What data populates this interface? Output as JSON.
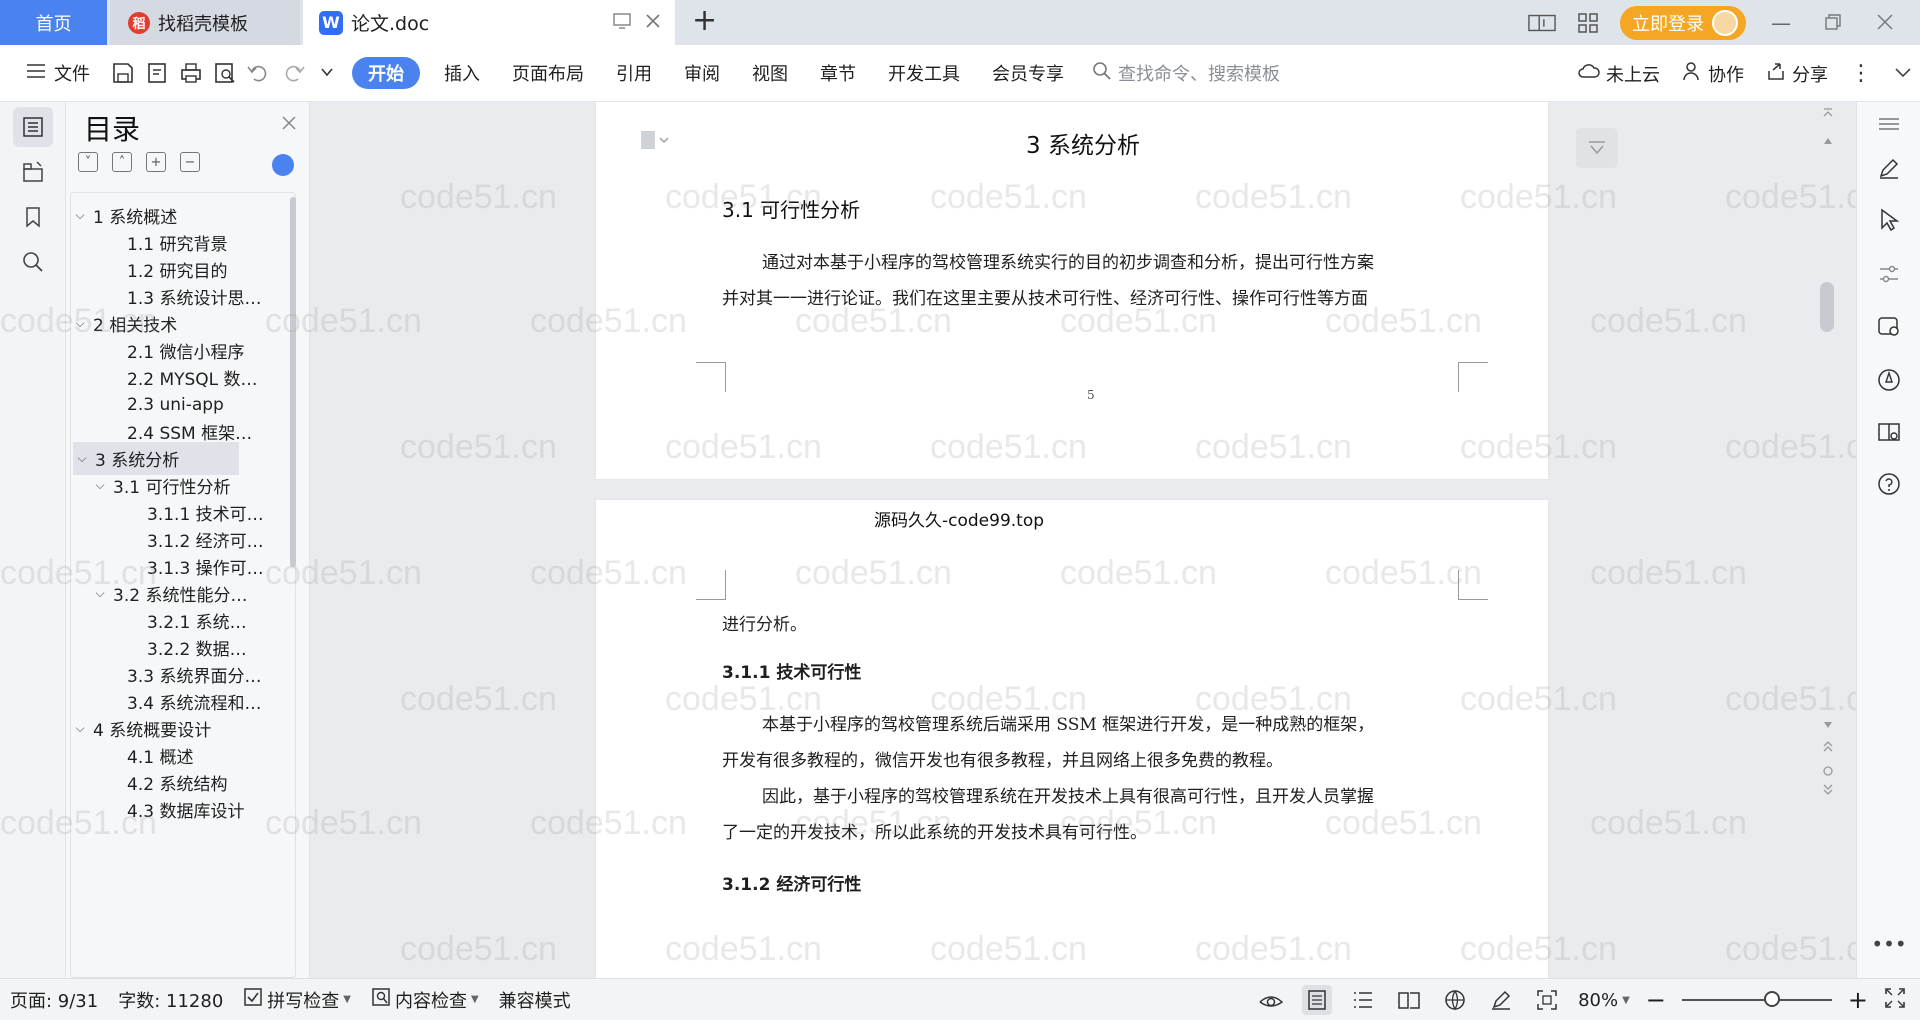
{
  "titlebar": {
    "home_tab": "首页",
    "template_tab": "找稻壳模板",
    "doc_tab": "论文.doc",
    "login_label": "立即登录"
  },
  "menubar": {
    "file": "文件",
    "items": [
      "开始",
      "插入",
      "页面布局",
      "引用",
      "审阅",
      "视图",
      "章节",
      "开发工具",
      "会员专享"
    ],
    "search_placeholder": "查找命令、搜索模板",
    "cloud": "未上云",
    "collab": "协作",
    "share": "分享"
  },
  "toc": {
    "title": "目录",
    "items": [
      {
        "label": "1 系统概述",
        "level": 1,
        "chevron": true
      },
      {
        "label": "1.1  研究背景",
        "level": 2,
        "chevron": false
      },
      {
        "label": "1.2 研究目的",
        "level": 2,
        "chevron": false
      },
      {
        "label": "1.3 系统设计思…",
        "level": 2,
        "chevron": false
      },
      {
        "label": "2 相关技术",
        "level": 1,
        "chevron": true
      },
      {
        "label": "2.1 微信小程序",
        "level": 2,
        "chevron": false
      },
      {
        "label": "2.2 MYSQL 数…",
        "level": 2,
        "chevron": false
      },
      {
        "label": "2.3 uni-app",
        "level": 2,
        "chevron": false
      },
      {
        "label": "2.4 SSM 框架…",
        "level": 2,
        "chevron": false
      },
      {
        "label": "3 系统分析",
        "level": 1,
        "chevron": true,
        "selected": true
      },
      {
        "label": "3.1 可行性分析",
        "level": 2,
        "chevron": true
      },
      {
        "label": "3.1.1 技术可…",
        "level": 3,
        "chevron": false
      },
      {
        "label": "3.1.2 经济可…",
        "level": 3,
        "chevron": false
      },
      {
        "label": "3.1.3 操作可…",
        "level": 3,
        "chevron": false
      },
      {
        "label": "3.2 系统性能分…",
        "level": 2,
        "chevron": true
      },
      {
        "label": "3.2.1  系统…",
        "level": 3,
        "chevron": false
      },
      {
        "label": "3.2.2  数据…",
        "level": 3,
        "chevron": false
      },
      {
        "label": "3.3 系统界面分…",
        "level": 2,
        "chevron": false
      },
      {
        "label": "3.4 系统流程和…",
        "level": 2,
        "chevron": false
      },
      {
        "label": "4 系统概要设计",
        "level": 1,
        "chevron": true
      },
      {
        "label": "4.1 概述",
        "level": 2,
        "chevron": false
      },
      {
        "label": "4.2 系统结构",
        "level": 2,
        "chevron": false
      },
      {
        "label": "4.3 数据库设计",
        "level": 2,
        "chevron": false
      }
    ]
  },
  "document": {
    "page1": {
      "heading": "3 系统分析",
      "section": "3.1 可行性分析",
      "para_line1": "通过对本基于小程序的驾校管理系统实行的目的初步调查和分析，提出可行性方案",
      "para_line2": "并对其一一进行论证。我们在这里主要从技术可行性、经济可行性、操作可行性等方面",
      "page_number": "5"
    },
    "page2": {
      "header": "源码久久-code99.top",
      "continuation": "进行分析。",
      "sub1": "3.1.1 技术可行性",
      "p1_line1": "本基于小程序的驾校管理系统后端采用 SSM 框架进行开发，是一种成熟的框架，",
      "p1_line2": "开发有很多教程的，微信开发也有很多教程，并且网络上很多免费的教程。",
      "p2_line1": "因此，基于小程序的驾校管理系统在开发技术上具有很高可行性，且开发人员掌握",
      "p2_line2": "了一定的开发技术，所以此系统的开发技术具有可行性。",
      "sub2": "3.1.2 经济可行性"
    },
    "watermark": "code51.cn"
  },
  "statusbar": {
    "page": "页面: 9/31",
    "words": "字数: 11280",
    "spell": "拼写检查",
    "content": "内容检查",
    "compat": "兼容模式",
    "zoom": "80%",
    "zoom_level": 0.6
  },
  "colors": {
    "accent": "#4a83f0",
    "login": "#f5a623"
  }
}
